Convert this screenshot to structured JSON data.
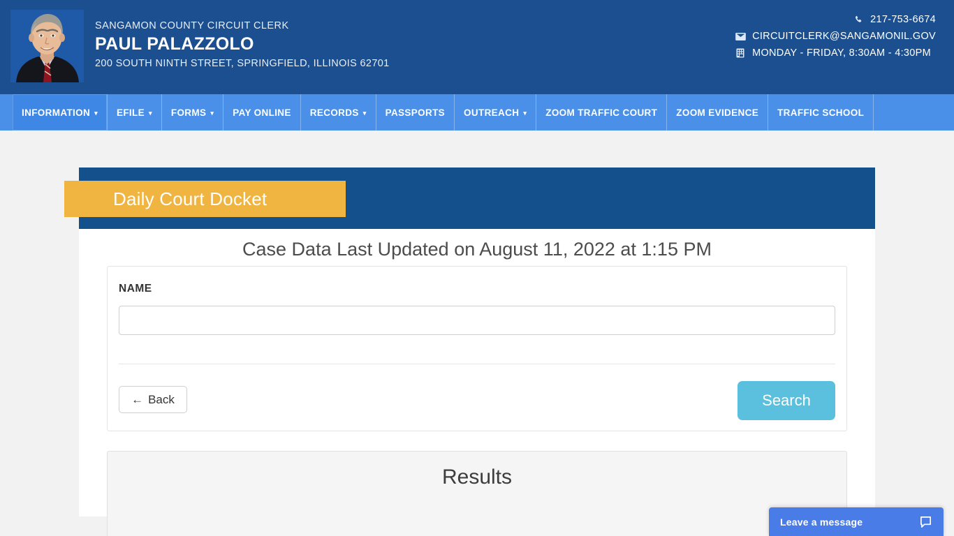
{
  "header": {
    "org_subtitle": "SANGAMON COUNTY CIRCUIT CLERK",
    "org_name": "PAUL PALAZZOLO",
    "org_address": "200 SOUTH NINTH STREET, SPRINGFIELD, ILLINOIS 62701",
    "portrait_alt": "portrait-photo",
    "contact": [
      {
        "icon": "phone-icon",
        "text": "217-753-6674"
      },
      {
        "icon": "envelope-icon",
        "text": "CIRCUITCLERK@SANGAMONIL.GOV"
      },
      {
        "icon": "calendar-icon",
        "text": "MONDAY - FRIDAY, 8:30AM - 4:30PM"
      }
    ]
  },
  "nav": {
    "items": [
      {
        "label": "INFORMATION",
        "caret": true,
        "active": true
      },
      {
        "label": "EFILE",
        "caret": true,
        "active": false
      },
      {
        "label": "FORMS",
        "caret": true,
        "active": false
      },
      {
        "label": "PAY ONLINE",
        "caret": false,
        "active": false
      },
      {
        "label": "RECORDS",
        "caret": true,
        "active": false
      },
      {
        "label": "PASSPORTS",
        "caret": false,
        "active": false
      },
      {
        "label": "OUTREACH",
        "caret": true,
        "active": false
      },
      {
        "label": "ZOOM TRAFFIC COURT",
        "caret": false,
        "active": false
      },
      {
        "label": "ZOOM EVIDENCE",
        "caret": false,
        "active": false
      },
      {
        "label": "TRAFFIC SCHOOL",
        "caret": false,
        "active": false
      }
    ]
  },
  "page": {
    "ribbon_title": "Daily Court Docket",
    "updated_heading": "Case Data Last Updated on August 11, 2022 at 1:15 PM"
  },
  "search_form": {
    "name_label": "NAME",
    "name_value": "",
    "name_placeholder": "",
    "back_arrow": "←",
    "back_label": "Back",
    "search_label": "Search"
  },
  "results": {
    "title": "Results"
  },
  "chat": {
    "label": "Leave a message",
    "icon": "chat-bubble-icon"
  },
  "colors": {
    "header_blue": "#1b4f8f",
    "nav_blue": "#4a90e8",
    "nav_active_blue": "#3f87e4",
    "band_blue": "#14508c",
    "ribbon_yellow": "#f0b440",
    "search_button": "#5bc0dd",
    "chat_blue": "#4a7ce8",
    "page_background": "#f2f2f2"
  }
}
